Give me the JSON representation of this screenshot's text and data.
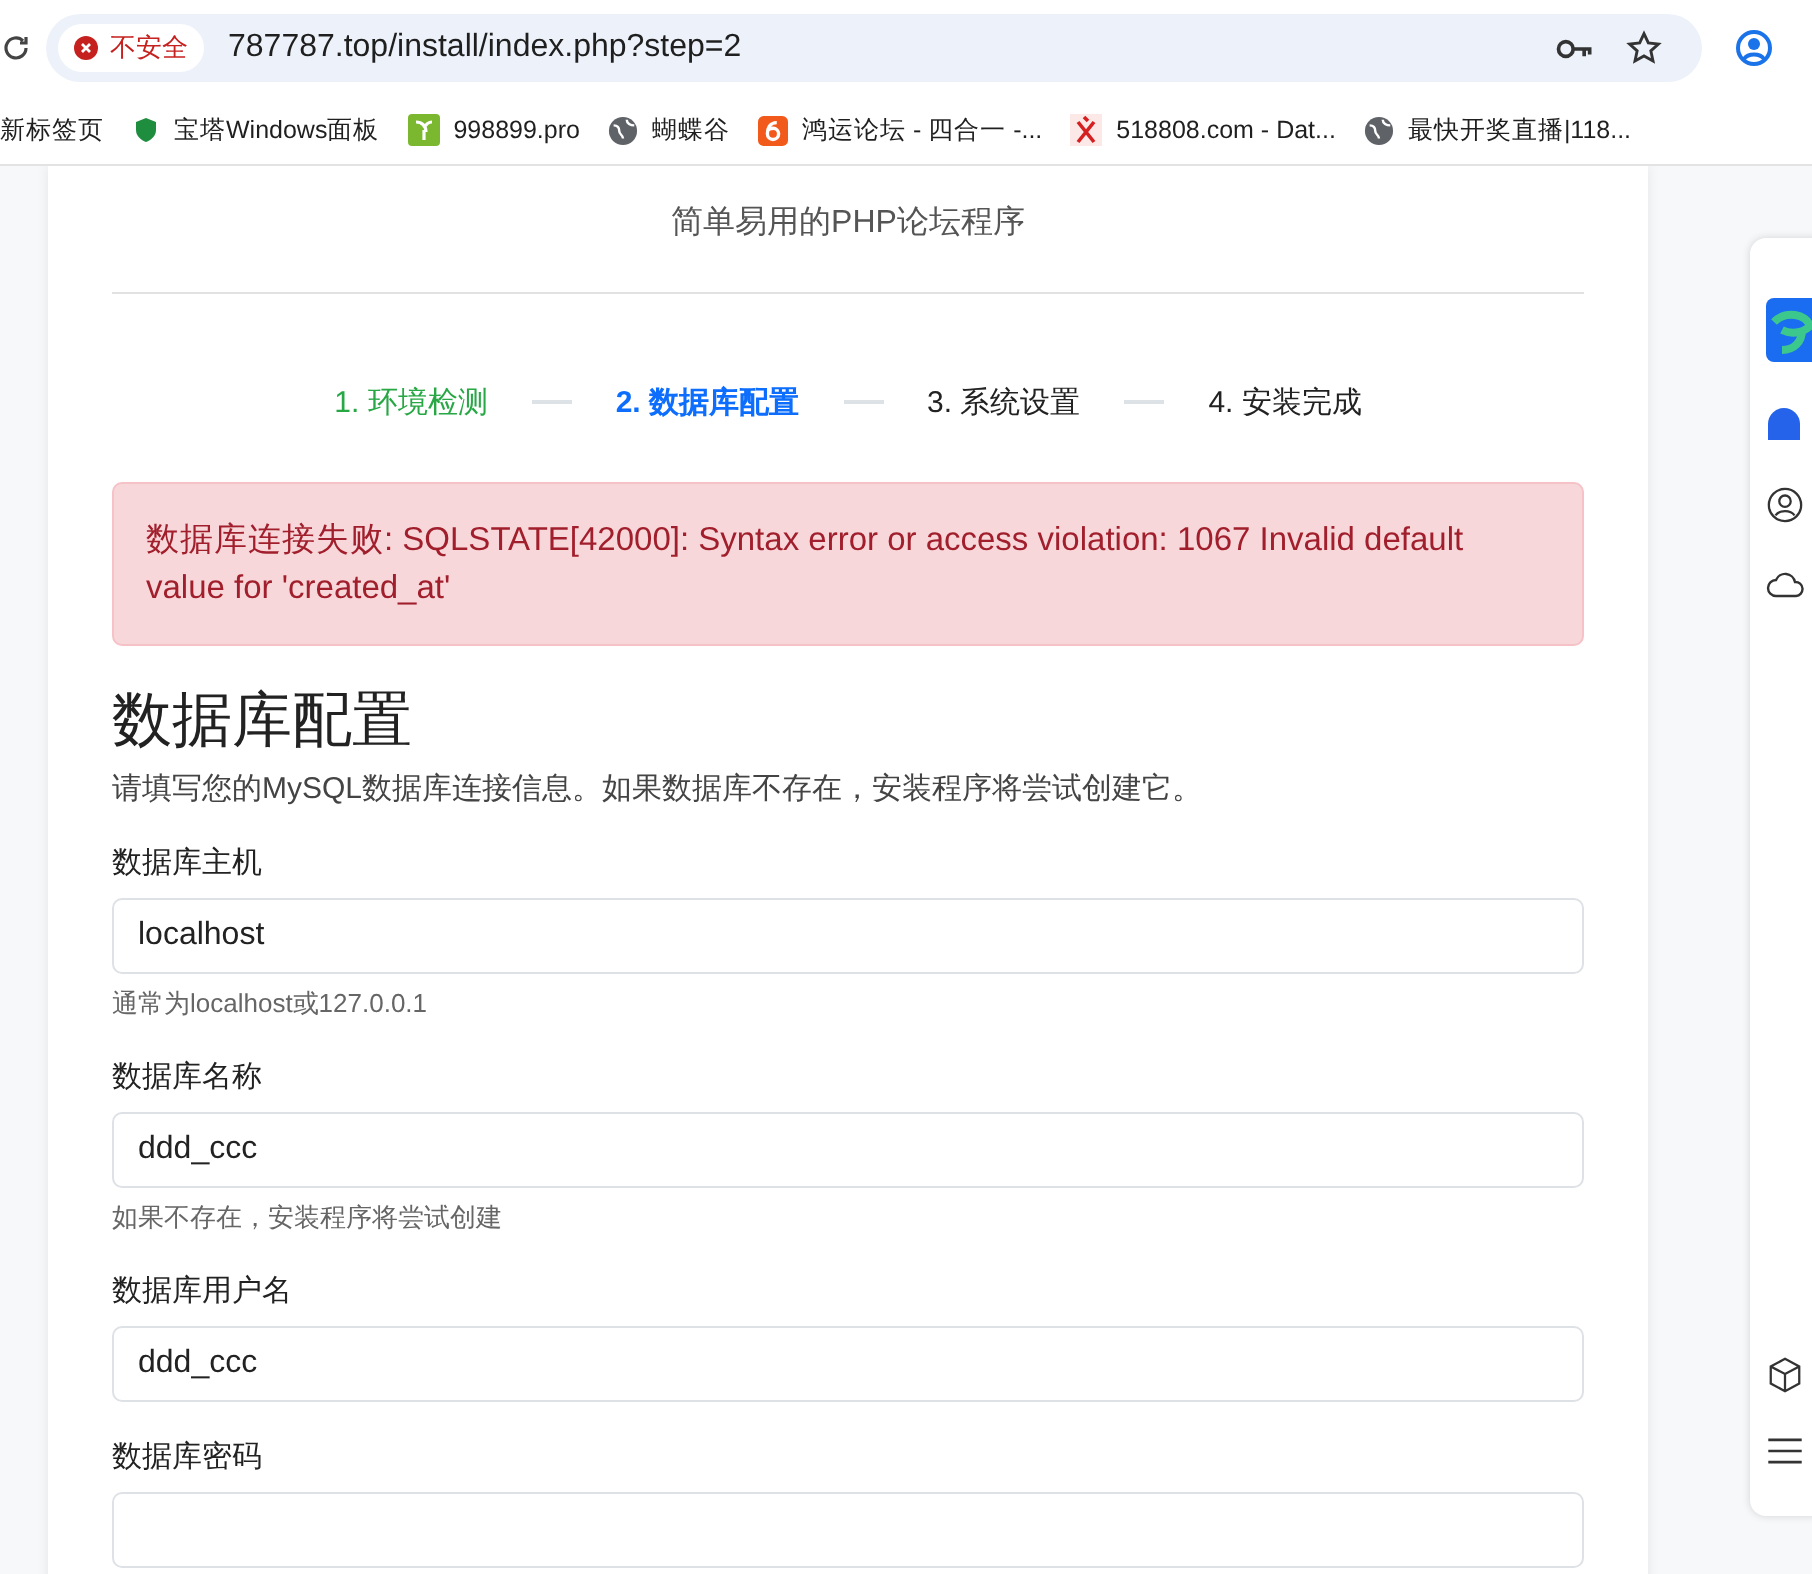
{
  "browser": {
    "security_label": "不安全",
    "url": "787787.top/install/index.php?step=2"
  },
  "bookmarks": [
    {
      "label": "新标签页",
      "kind": "none"
    },
    {
      "label": "宝塔Windows面板",
      "kind": "shield"
    },
    {
      "label": "998899.pro",
      "kind": "leaf"
    },
    {
      "label": "蝴蝶谷",
      "kind": "globe"
    },
    {
      "label": "鸿运论坛 - 四合一 -...",
      "kind": "six"
    },
    {
      "label": "518808.com - Dat...",
      "kind": "yi"
    },
    {
      "label": "最快开奖直播|118...",
      "kind": "globe"
    }
  ],
  "page": {
    "subtitle": "简单易用的PHP论坛程序",
    "steps": [
      {
        "label": "1. 环境检测",
        "done": true,
        "selected": false
      },
      {
        "label": "2. 数据库配置",
        "done": false,
        "selected": true
      },
      {
        "label": "3. 系统设置",
        "done": false,
        "selected": false
      },
      {
        "label": "4. 安装完成",
        "done": false,
        "selected": false
      }
    ],
    "alert": {
      "kind": "error",
      "text": "数据库连接失败: SQLSTATE[42000]: Syntax error or access violation: 1067 Invalid default value for 'created_at'"
    },
    "heading": "数据库配置",
    "description": "请填写您的MySQL数据库连接信息。如果数据库不存在，安装程序将尝试创建它。",
    "fields": [
      {
        "label": "数据库主机",
        "value": "localhost",
        "help": "通常为localhost或127.0.0.1"
      },
      {
        "label": "数据库名称",
        "value": "ddd_ccc",
        "help": "如果不存在，安装程序将尝试创建"
      },
      {
        "label": "数据库用户名",
        "value": "ddd_ccc"
      },
      {
        "label": "数据库密码"
      }
    ]
  }
}
